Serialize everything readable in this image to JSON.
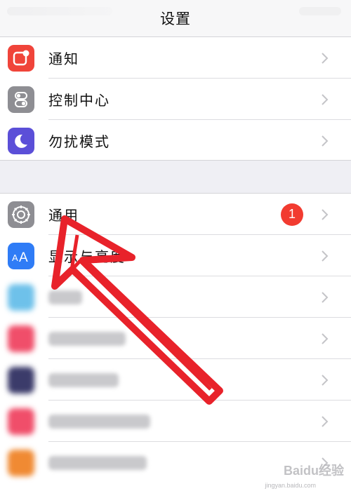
{
  "header": {
    "title": "设置"
  },
  "group1": [
    {
      "label": "通知",
      "icon": "notification-icon",
      "color": "#f0443a"
    },
    {
      "label": "控制中心",
      "icon": "toggle-switches-icon",
      "color": "#8e8e93"
    },
    {
      "label": "勿扰模式",
      "icon": "moon-icon",
      "color": "#5b4fd8"
    }
  ],
  "group2": [
    {
      "label": "通用",
      "icon": "gear-icon",
      "color": "#8e8e93",
      "badge": "1"
    },
    {
      "label": "显示与亮度",
      "icon": "text-size-icon",
      "color": "#2f7cf6"
    },
    {
      "icon": "blurred-app-icon",
      "color": "#6ec1ea"
    },
    {
      "icon": "blurred-app-icon",
      "color": "#f04e6a"
    },
    {
      "icon": "blurred-app-icon",
      "color": "#3b3b6a"
    },
    {
      "icon": "blurred-app-icon",
      "color": "#f04e6a"
    },
    {
      "icon": "blurred-app-icon",
      "color": "#f08a33"
    }
  ],
  "watermark": {
    "text": "Baidu经验",
    "sub": "jingyan.baidu.com"
  },
  "annotation": {
    "arrow_color": "#e8222a",
    "icon": "red-arrow-annotation-icon"
  },
  "badge_color": "#f23b30"
}
